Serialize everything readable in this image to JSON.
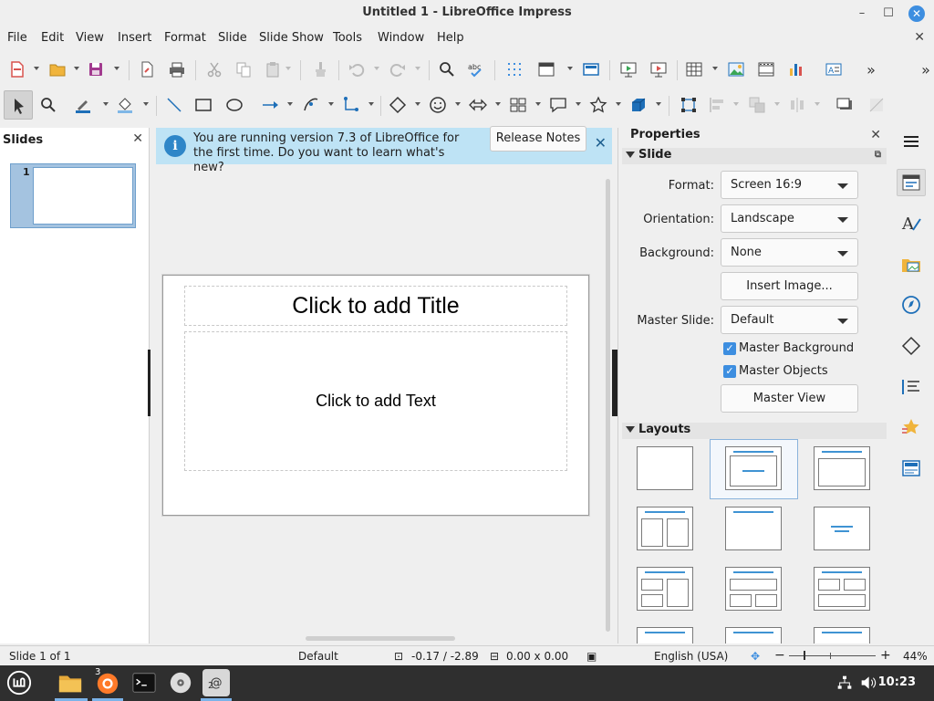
{
  "window": {
    "title": "Untitled 1 - LibreOffice Impress",
    "minimize": "–",
    "maximize": "☐",
    "close": "✕",
    "doc_close": "✕"
  },
  "menu": [
    "File",
    "Edit",
    "View",
    "Insert",
    "Format",
    "Slide",
    "Slide Show",
    "Tools",
    "Window",
    "Help"
  ],
  "slides_pane": {
    "title": "Slides",
    "close": "✕",
    "thumb_number": "1"
  },
  "infobar": {
    "icon": "i",
    "message": "You are running version 7.3 of LibreOffice for the first time. Do you want to learn what's new?",
    "button": "Release Notes",
    "close": "✕"
  },
  "slide": {
    "title_placeholder": "Click to add Title",
    "text_placeholder": "Click to add Text"
  },
  "properties": {
    "title": "Properties",
    "close": "✕",
    "slide_section": "Slide",
    "format_label": "Format:",
    "format_value": "Screen 16:9",
    "orientation_label": "Orientation:",
    "orientation_value": "Landscape",
    "background_label": "Background:",
    "background_value": "None",
    "insert_image": "Insert Image...",
    "master_slide_label": "Master Slide:",
    "master_slide_value": "Default",
    "master_background": "Master Background",
    "master_objects": "Master Objects",
    "master_view": "Master View",
    "layouts_section": "Layouts"
  },
  "status": {
    "slide": "Slide 1 of 1",
    "master": "Default",
    "position": "-0.17 / -2.89",
    "size": "0.00 x 0.00",
    "language": "English (USA)",
    "zoom": "44%",
    "zoom_minus": "−",
    "zoom_plus": "+"
  },
  "taskbar": {
    "clock": "10:23",
    "firefox_badge": "3",
    "mail_badge": "2"
  },
  "colors": {
    "accent": "#3d8ee0",
    "infobar": "#bee3f5",
    "layout_line": "#3f93d3"
  }
}
